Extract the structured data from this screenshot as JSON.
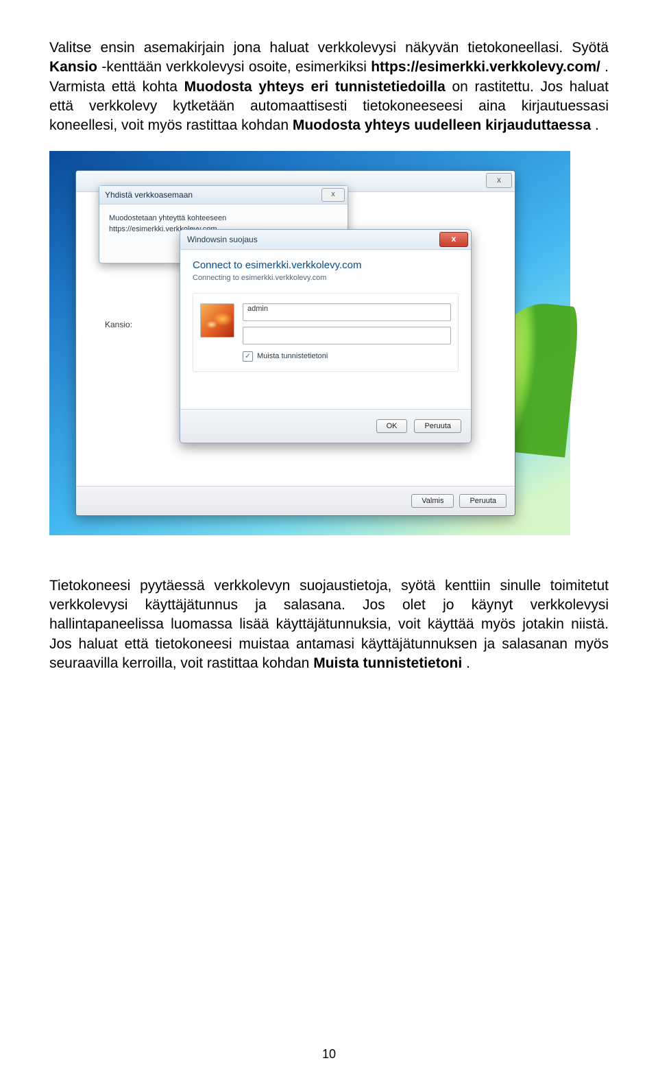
{
  "paragraphs": {
    "p1": {
      "t1": "Valitse ensin asemakirjain jona haluat verkkolevysi näkyvän tietokoneellasi. Syötä ",
      "b1": "Kansio",
      "t2": " -kenttään verkkolevysi osoite, esimerkiksi ",
      "b2": "https://esimerkki.verkkolevy.com/",
      "t3": ". Varmista että kohta ",
      "b3": "Muodosta yhteys eri tunnistetiedoilla",
      "t4": " on rastitettu. Jos haluat että verkkolevy kytketään automaattisesti tietokoneeseesi aina kirjautuessasi koneellesi, voit myös rastittaa kohdan ",
      "b4": "Muodosta yhteys uudelleen kirjauduttaessa",
      "t5": "."
    },
    "p2": {
      "t1": "Tietokoneesi pyytäessä verkkolevyn suojaustietoja, syötä kenttiin sinulle toimitetut verkkolevysi käyttäjätunnus ja salasana. Jos olet jo käynyt verkkolevysi hallintapaneelissa luomassa lisää käyttäjätunnuksia, voit käyttää myös jotakin niistä. Jos haluat että tietokoneesi muistaa antamasi käyttäjätunnuksen ja salasanan myös seuraavilla kerroilla, voit rastittaa kohdan ",
      "b1": "Muista tunnistetietoni",
      "t2": "."
    }
  },
  "wizard": {
    "kansio_label": "Kansio:",
    "close_glyph": "x",
    "buttons": {
      "finish": "Valmis",
      "cancel": "Peruuta"
    }
  },
  "progress": {
    "title": "Yhdistä verkkoasemaan",
    "line1": "Muodostetaan yhteyttä kohteeseen",
    "line2": "https://esimerkki.verkkolevy.com..."
  },
  "cred": {
    "title": "Windowsin suojaus",
    "heading": "Connect to esimerkki.verkkolevy.com",
    "sub": "Connecting to esimerkki.verkkolevy.com",
    "username": "admin",
    "password": "",
    "checkbox_label": "Muista tunnistetietoni",
    "checkbox_checked": "✓",
    "buttons": {
      "ok": "OK",
      "cancel": "Peruuta"
    }
  },
  "page_number": "10"
}
